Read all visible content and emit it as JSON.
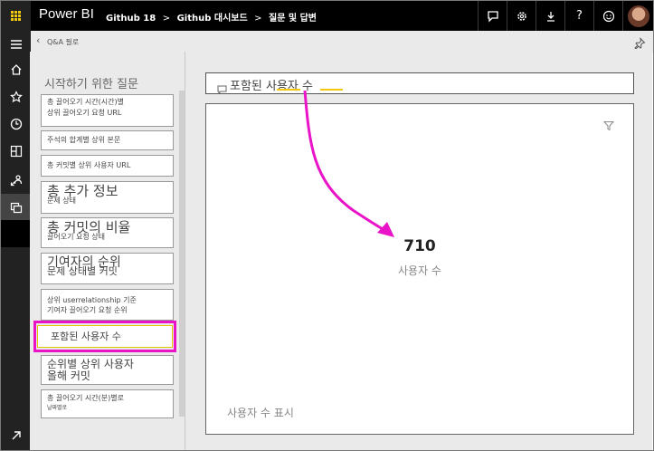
{
  "app": {
    "brand": "Power BI",
    "breadcrumbs": [
      "Github 18",
      "Github 대시보드",
      "질문 및 답변"
    ],
    "breadcrumb_sep": ">",
    "subheader_label": "Q&A 필로"
  },
  "topbar_icons": [
    "chat-icon",
    "gear-icon",
    "download-icon",
    "help-icon",
    "smiley-icon"
  ],
  "topbar_glyphs": {
    "help": "?"
  },
  "rail_icons": [
    "menu-icon",
    "home-icon",
    "star-icon",
    "clock-icon",
    "apps-icon",
    "shared-icon",
    "workspaces-icon"
  ],
  "questions_pane": {
    "title": "시작하기 위한 질문",
    "items": [
      {
        "l1": "총 끌어오기 시간(시간)별",
        "l2": "상위 끌어오기 요청 URL"
      },
      {
        "l1": "주석의 합계별 상위 본문",
        "l2": ""
      },
      {
        "l1": "총 커밋별 상위 사용자 URL",
        "l2": ""
      },
      {
        "l1": "총 추가 정보",
        "l2": "문제 상태"
      },
      {
        "l1": "총 커밋의 비율",
        "l2": "끌어오기 요청 상태"
      },
      {
        "l1": "기여자의 순위",
        "l2": "문제 상태별 커밋"
      },
      {
        "l1": "상위 userrelationship 기준",
        "l2": "기여자 끌어오기 요청 순위"
      },
      {
        "l1": "포함된 사용자 수",
        "l2": ""
      },
      {
        "l1": "순위별 상위 사용자",
        "l2": "올해 커밋"
      },
      {
        "l1": "총 끌어오기 시간(분)별로",
        "l2": "날짜별로"
      }
    ]
  },
  "qa": {
    "query": "포함된 사용자 수",
    "result_value": "710",
    "result_label": "사용자 수",
    "show_label": "사용자 수 표시"
  },
  "colors": {
    "accent": "#f2c811",
    "highlight": "#e914c8",
    "topbar": "#000000",
    "rail": "#222222",
    "pane": "#eaeaea"
  }
}
